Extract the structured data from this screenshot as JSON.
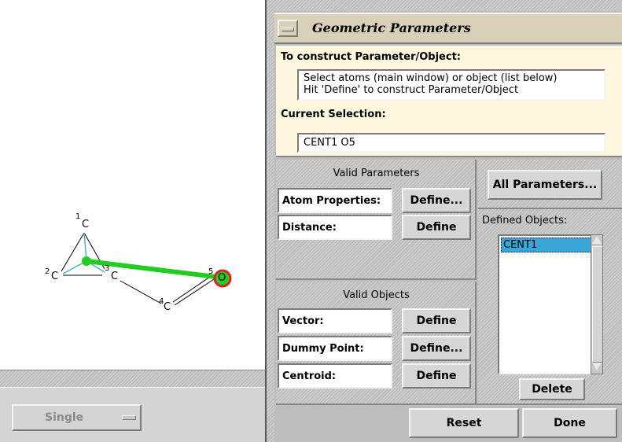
{
  "molecule": {
    "atoms": [
      {
        "num": "1",
        "symbol": "C"
      },
      {
        "num": "2",
        "symbol": "C"
      },
      {
        "num": "3",
        "symbol": "C"
      },
      {
        "num": "4",
        "symbol": "C"
      },
      {
        "num": "5",
        "symbol": "O"
      }
    ]
  },
  "bottom_bar": {
    "select_mode": "Single"
  },
  "dialog": {
    "title": "Geometric Parameters",
    "construct_heading": "To construct Parameter/Object:",
    "instructions_line1": "Select atoms (main window) or object (list below)",
    "instructions_line2": "Hit 'Define' to construct Parameter/Object",
    "current_selection_heading": "Current Selection:",
    "current_selection_value": "CENT1 O5",
    "valid_parameters": {
      "heading": "Valid Parameters",
      "atom_properties_label": "Atom Properties:",
      "atom_properties_button": "Define...",
      "distance_label": "Distance:",
      "distance_button": "Define"
    },
    "valid_objects": {
      "heading": "Valid Objects",
      "vector_label": "Vector:",
      "vector_button": "Define",
      "dummy_point_label": "Dummy Point:",
      "dummy_point_button": "Define...",
      "centroid_label": "Centroid:",
      "centroid_button": "Define"
    },
    "all_parameters_button": "All Parameters...",
    "defined_objects_heading": "Defined Objects:",
    "defined_objects": [
      "CENT1"
    ],
    "delete_button": "Delete",
    "reset_button": "Reset",
    "done_button": "Done"
  },
  "colors": {
    "title_bar": "#d8d0b8",
    "instruction_panel": "#fff8de",
    "selected_item": "#3aa6d8",
    "bond_highlight": "#22cc22",
    "oxygen_ring": "#dd2222"
  }
}
